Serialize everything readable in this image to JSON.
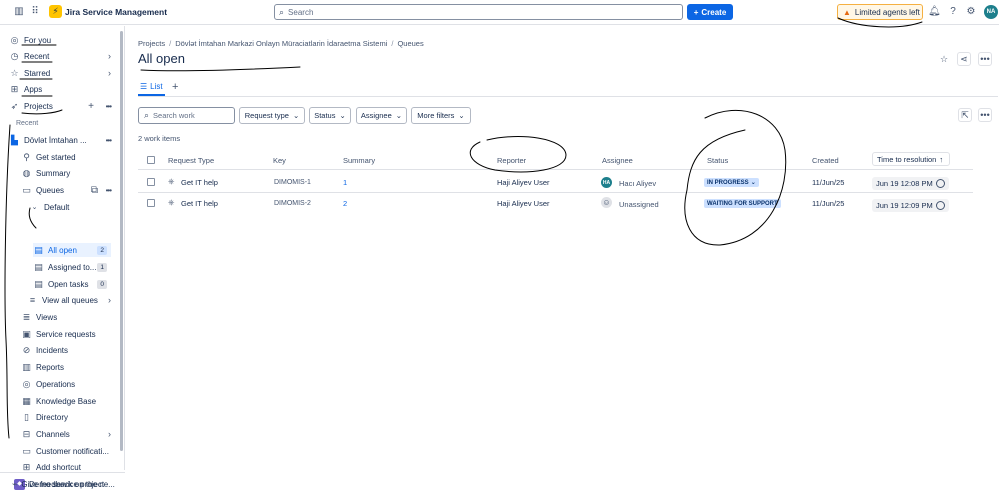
{
  "topbar": {
    "app_title": "Jira Service Management",
    "search_placeholder": "Search",
    "create_label": "Create",
    "limited_label": "Limited agents left",
    "avatar_initials": "NA"
  },
  "sidebar": {
    "top_items": [
      {
        "label": "For you",
        "icon": "person-circle-icon"
      },
      {
        "label": "Recent",
        "icon": "clock-icon"
      },
      {
        "label": "Starred",
        "icon": "star-icon"
      },
      {
        "label": "Apps",
        "icon": "apps-grid-icon"
      },
      {
        "label": "Projects",
        "icon": "rocket-icon"
      }
    ],
    "recent_label": "Recent",
    "project": {
      "name": "Dövlət İmtahan ...",
      "icon": "project-icon"
    },
    "project_items": [
      {
        "label": "Get started"
      },
      {
        "label": "Summary"
      },
      {
        "label": "Queues"
      },
      {
        "label": "Default"
      },
      {
        "label": "All open",
        "badge": "2"
      },
      {
        "label": "Assigned to...",
        "badge": "1"
      },
      {
        "label": "Open tasks",
        "badge": "0"
      },
      {
        "label": "View all queues"
      },
      {
        "label": "Views"
      },
      {
        "label": "Service requests"
      },
      {
        "label": "Incidents"
      },
      {
        "label": "Reports"
      },
      {
        "label": "Operations"
      },
      {
        "label": "Knowledge Base"
      },
      {
        "label": "Directory"
      },
      {
        "label": "Channels"
      },
      {
        "label": "Customer notificati..."
      },
      {
        "label": "Add shortcut"
      }
    ],
    "demo_project": "Demo service project",
    "feedback": "Give feedback on the ne..."
  },
  "header": {
    "breadcrumb": [
      "Projects",
      "Dövlət İmtahan Markazi Onlayn Müraciatlarin İdaraetma Sistemi",
      "Queues"
    ],
    "title": "All open"
  },
  "tabs": {
    "list_label": "List"
  },
  "filters": {
    "search_placeholder": "Search work",
    "request_type": "Request type",
    "status": "Status",
    "assignee": "Assignee",
    "more_filters": "More filters"
  },
  "count_text": "2 work items",
  "table": {
    "headers": {
      "request_type": "Request Type",
      "key": "Key",
      "summary": "Summary",
      "reporter": "Reporter",
      "assignee": "Assignee",
      "status": "Status",
      "created": "Created",
      "time_to_resolution": "Time to resolution"
    },
    "rows": [
      {
        "request_type": "Get IT help",
        "key": "DIMOMIS-1",
        "summary": "1",
        "reporter": "Haji Aliyev User",
        "assignee": "Hacı Aliyev",
        "assignee_initials": "HA",
        "status": "IN PROGRESS",
        "created": "11/Jun/25",
        "ttr": "Jun 19 12:08 PM"
      },
      {
        "request_type": "Get IT help",
        "key": "DIMOMIS-2",
        "summary": "2",
        "reporter": "Haji Aliyev User",
        "assignee": "Unassigned",
        "assignee_initials": "",
        "status": "WAITING FOR SUPPORT",
        "created": "11/Jun/25",
        "ttr": "Jun 19 12:09 PM"
      }
    ]
  },
  "colors": {
    "accent": "#0c66e4",
    "status_bg": "#cce0ff",
    "warning": "#e56910"
  }
}
